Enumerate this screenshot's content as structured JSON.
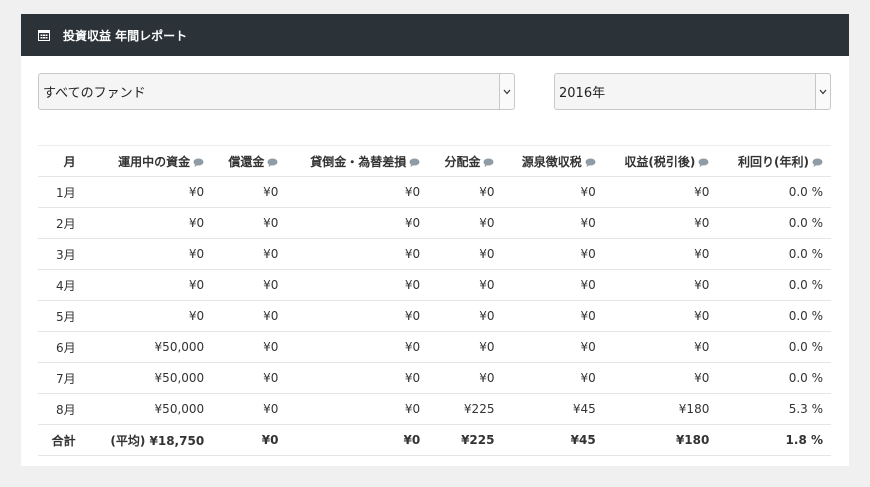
{
  "header": {
    "title": "投資収益 年間レポート"
  },
  "filters": {
    "fund": "すべてのファンド",
    "year": "2016年"
  },
  "table": {
    "columns": [
      "月",
      "運用中の資金",
      "償還金",
      "貸倒金・為替差損",
      "分配金",
      "源泉徴収税",
      "収益(税引後)",
      "利回り(年利)"
    ],
    "rows": [
      [
        "1月",
        "¥0",
        "¥0",
        "¥0",
        "¥0",
        "¥0",
        "¥0",
        "0.0 %"
      ],
      [
        "2月",
        "¥0",
        "¥0",
        "¥0",
        "¥0",
        "¥0",
        "¥0",
        "0.0 %"
      ],
      [
        "3月",
        "¥0",
        "¥0",
        "¥0",
        "¥0",
        "¥0",
        "¥0",
        "0.0 %"
      ],
      [
        "4月",
        "¥0",
        "¥0",
        "¥0",
        "¥0",
        "¥0",
        "¥0",
        "0.0 %"
      ],
      [
        "5月",
        "¥0",
        "¥0",
        "¥0",
        "¥0",
        "¥0",
        "¥0",
        "0.0 %"
      ],
      [
        "6月",
        "¥50,000",
        "¥0",
        "¥0",
        "¥0",
        "¥0",
        "¥0",
        "0.0 %"
      ],
      [
        "7月",
        "¥50,000",
        "¥0",
        "¥0",
        "¥0",
        "¥0",
        "¥0",
        "0.0 %"
      ],
      [
        "8月",
        "¥50,000",
        "¥0",
        "¥0",
        "¥225",
        "¥45",
        "¥180",
        "5.3 %"
      ]
    ],
    "total": [
      "合計",
      "(平均) ¥18,750",
      "¥0",
      "¥0",
      "¥225",
      "¥45",
      "¥180",
      "1.8 %"
    ]
  }
}
